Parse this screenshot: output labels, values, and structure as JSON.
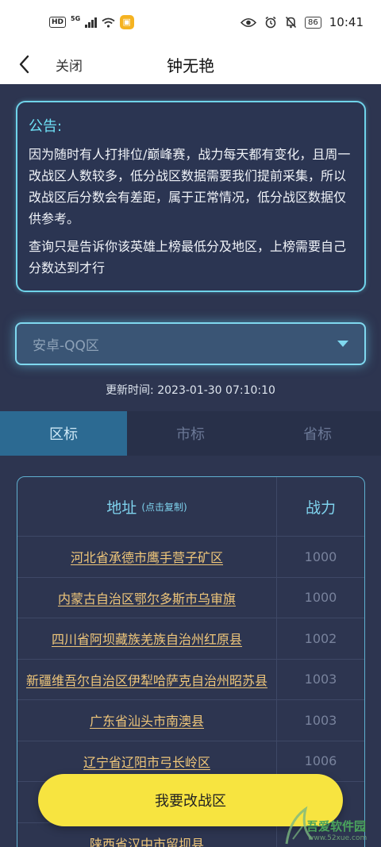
{
  "status_bar": {
    "hd": "HD",
    "network": "5G",
    "time": "10:41",
    "battery": "86"
  },
  "nav": {
    "close_label": "关闭",
    "title": "钟无艳"
  },
  "notice": {
    "title": "公告:",
    "paragraph1": "因为随时有人打排位/巅峰赛，战力每天都有变化，且周一改战区人数较多，低分战区数据需要我们提前采集，所以改战区后分数会有差距，属于正常情况，低分战区数据仅供参考。",
    "paragraph2": "查询只是告诉你该英雄上榜最低分及地区，上榜需要自己分数达到才行"
  },
  "region_select": {
    "value": "安卓-QQ区"
  },
  "update_time": "更新时间:  2023-01-30 07:10:10",
  "tabs": [
    {
      "label": "区标",
      "active": true
    },
    {
      "label": "市标",
      "active": false
    },
    {
      "label": "省标",
      "active": false
    }
  ],
  "table": {
    "header_address": "地址",
    "header_hint": "(点击复制)",
    "header_power": "战力",
    "rows": [
      {
        "address": "河北省承德市鹰手营子矿区",
        "power": "1000"
      },
      {
        "address": "内蒙古自治区鄂尔多斯市乌审旗",
        "power": "1000"
      },
      {
        "address": "四川省阿坝藏族羌族自治州红原县",
        "power": "1002"
      },
      {
        "address": "新疆维吾尔自治区伊犁哈萨克自治州昭苏县",
        "power": "1003"
      },
      {
        "address": "广东省汕头市南澳县",
        "power": "1003"
      },
      {
        "address": "辽宁省辽阳市弓长岭区",
        "power": "1006"
      },
      {
        "address": "",
        "power": ""
      },
      {
        "address": "陕西省汉中市留坝县",
        "power": ""
      }
    ]
  },
  "cta_label": "我要改战区",
  "watermark": {
    "name": "吾爱软件园",
    "url": "www.52xue.com"
  },
  "colors": {
    "background": "#2d3550",
    "accent_cyan": "#6ee0f5",
    "address_gold": "#f0c77a",
    "cta_yellow": "#f7e440",
    "active_tab": "#2c6a92"
  }
}
